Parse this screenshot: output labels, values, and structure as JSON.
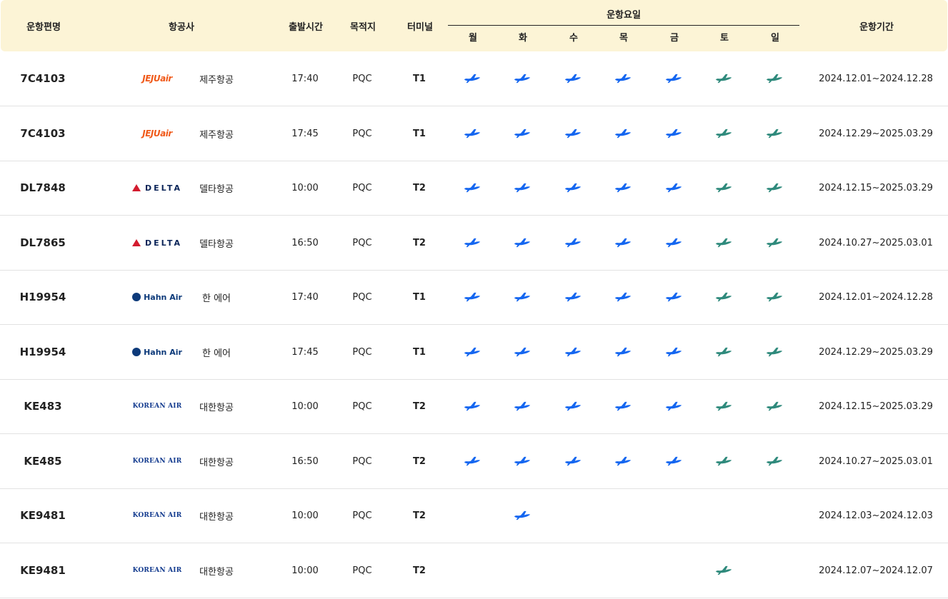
{
  "headers": {
    "flight": "운항편명",
    "airline": "항공사",
    "departure": "출발시간",
    "destination": "목적지",
    "terminal": "터미널",
    "days_group": "운항요일",
    "period": "운항기간"
  },
  "days": [
    "월",
    "화",
    "수",
    "목",
    "금",
    "토",
    "일"
  ],
  "colors": {
    "header_bg": "#fcf4d6",
    "weekday_plane": "#1466f0",
    "weekend_plane": "#2f8a7c"
  },
  "rows": [
    {
      "flight": "7C4103",
      "logo": "JEJUair",
      "logo_type": "jeju",
      "airline": "제주항공",
      "time": "17:40",
      "dest": "PQC",
      "terminal": "T1",
      "days": [
        1,
        1,
        1,
        1,
        1,
        1,
        1
      ],
      "period": "2024.12.01~2024.12.28"
    },
    {
      "flight": "7C4103",
      "logo": "JEJUair",
      "logo_type": "jeju",
      "airline": "제주항공",
      "time": "17:45",
      "dest": "PQC",
      "terminal": "T1",
      "days": [
        1,
        1,
        1,
        1,
        1,
        1,
        1
      ],
      "period": "2024.12.29~2025.03.29"
    },
    {
      "flight": "DL7848",
      "logo": "DELTA",
      "logo_type": "delta",
      "airline": "델타항공",
      "time": "10:00",
      "dest": "PQC",
      "terminal": "T2",
      "days": [
        1,
        1,
        1,
        1,
        1,
        1,
        1
      ],
      "period": "2024.12.15~2025.03.29"
    },
    {
      "flight": "DL7865",
      "logo": "DELTA",
      "logo_type": "delta",
      "airline": "델타항공",
      "time": "16:50",
      "dest": "PQC",
      "terminal": "T2",
      "days": [
        1,
        1,
        1,
        1,
        1,
        1,
        1
      ],
      "period": "2024.10.27~2025.03.01"
    },
    {
      "flight": "H19954",
      "logo": "Hahn Air",
      "logo_type": "hahn",
      "airline": "한 에어",
      "time": "17:40",
      "dest": "PQC",
      "terminal": "T1",
      "days": [
        1,
        1,
        1,
        1,
        1,
        1,
        1
      ],
      "period": "2024.12.01~2024.12.28"
    },
    {
      "flight": "H19954",
      "logo": "Hahn Air",
      "logo_type": "hahn",
      "airline": "한 에어",
      "time": "17:45",
      "dest": "PQC",
      "terminal": "T1",
      "days": [
        1,
        1,
        1,
        1,
        1,
        1,
        1
      ],
      "period": "2024.12.29~2025.03.29"
    },
    {
      "flight": "KE483",
      "logo": "KOREAN AIR",
      "logo_type": "korean",
      "airline": "대한항공",
      "time": "10:00",
      "dest": "PQC",
      "terminal": "T2",
      "days": [
        1,
        1,
        1,
        1,
        1,
        1,
        1
      ],
      "period": "2024.12.15~2025.03.29"
    },
    {
      "flight": "KE485",
      "logo": "KOREAN AIR",
      "logo_type": "korean",
      "airline": "대한항공",
      "time": "16:50",
      "dest": "PQC",
      "terminal": "T2",
      "days": [
        1,
        1,
        1,
        1,
        1,
        1,
        1
      ],
      "period": "2024.10.27~2025.03.01"
    },
    {
      "flight": "KE9481",
      "logo": "KOREAN AIR",
      "logo_type": "korean",
      "airline": "대한항공",
      "time": "10:00",
      "dest": "PQC",
      "terminal": "T2",
      "days": [
        0,
        1,
        0,
        0,
        0,
        0,
        0
      ],
      "period": "2024.12.03~2024.12.03"
    },
    {
      "flight": "KE9481",
      "logo": "KOREAN AIR",
      "logo_type": "korean",
      "airline": "대한항공",
      "time": "10:00",
      "dest": "PQC",
      "terminal": "T2",
      "days": [
        0,
        0,
        0,
        0,
        0,
        1,
        0
      ],
      "period": "2024.12.07~2024.12.07"
    }
  ]
}
